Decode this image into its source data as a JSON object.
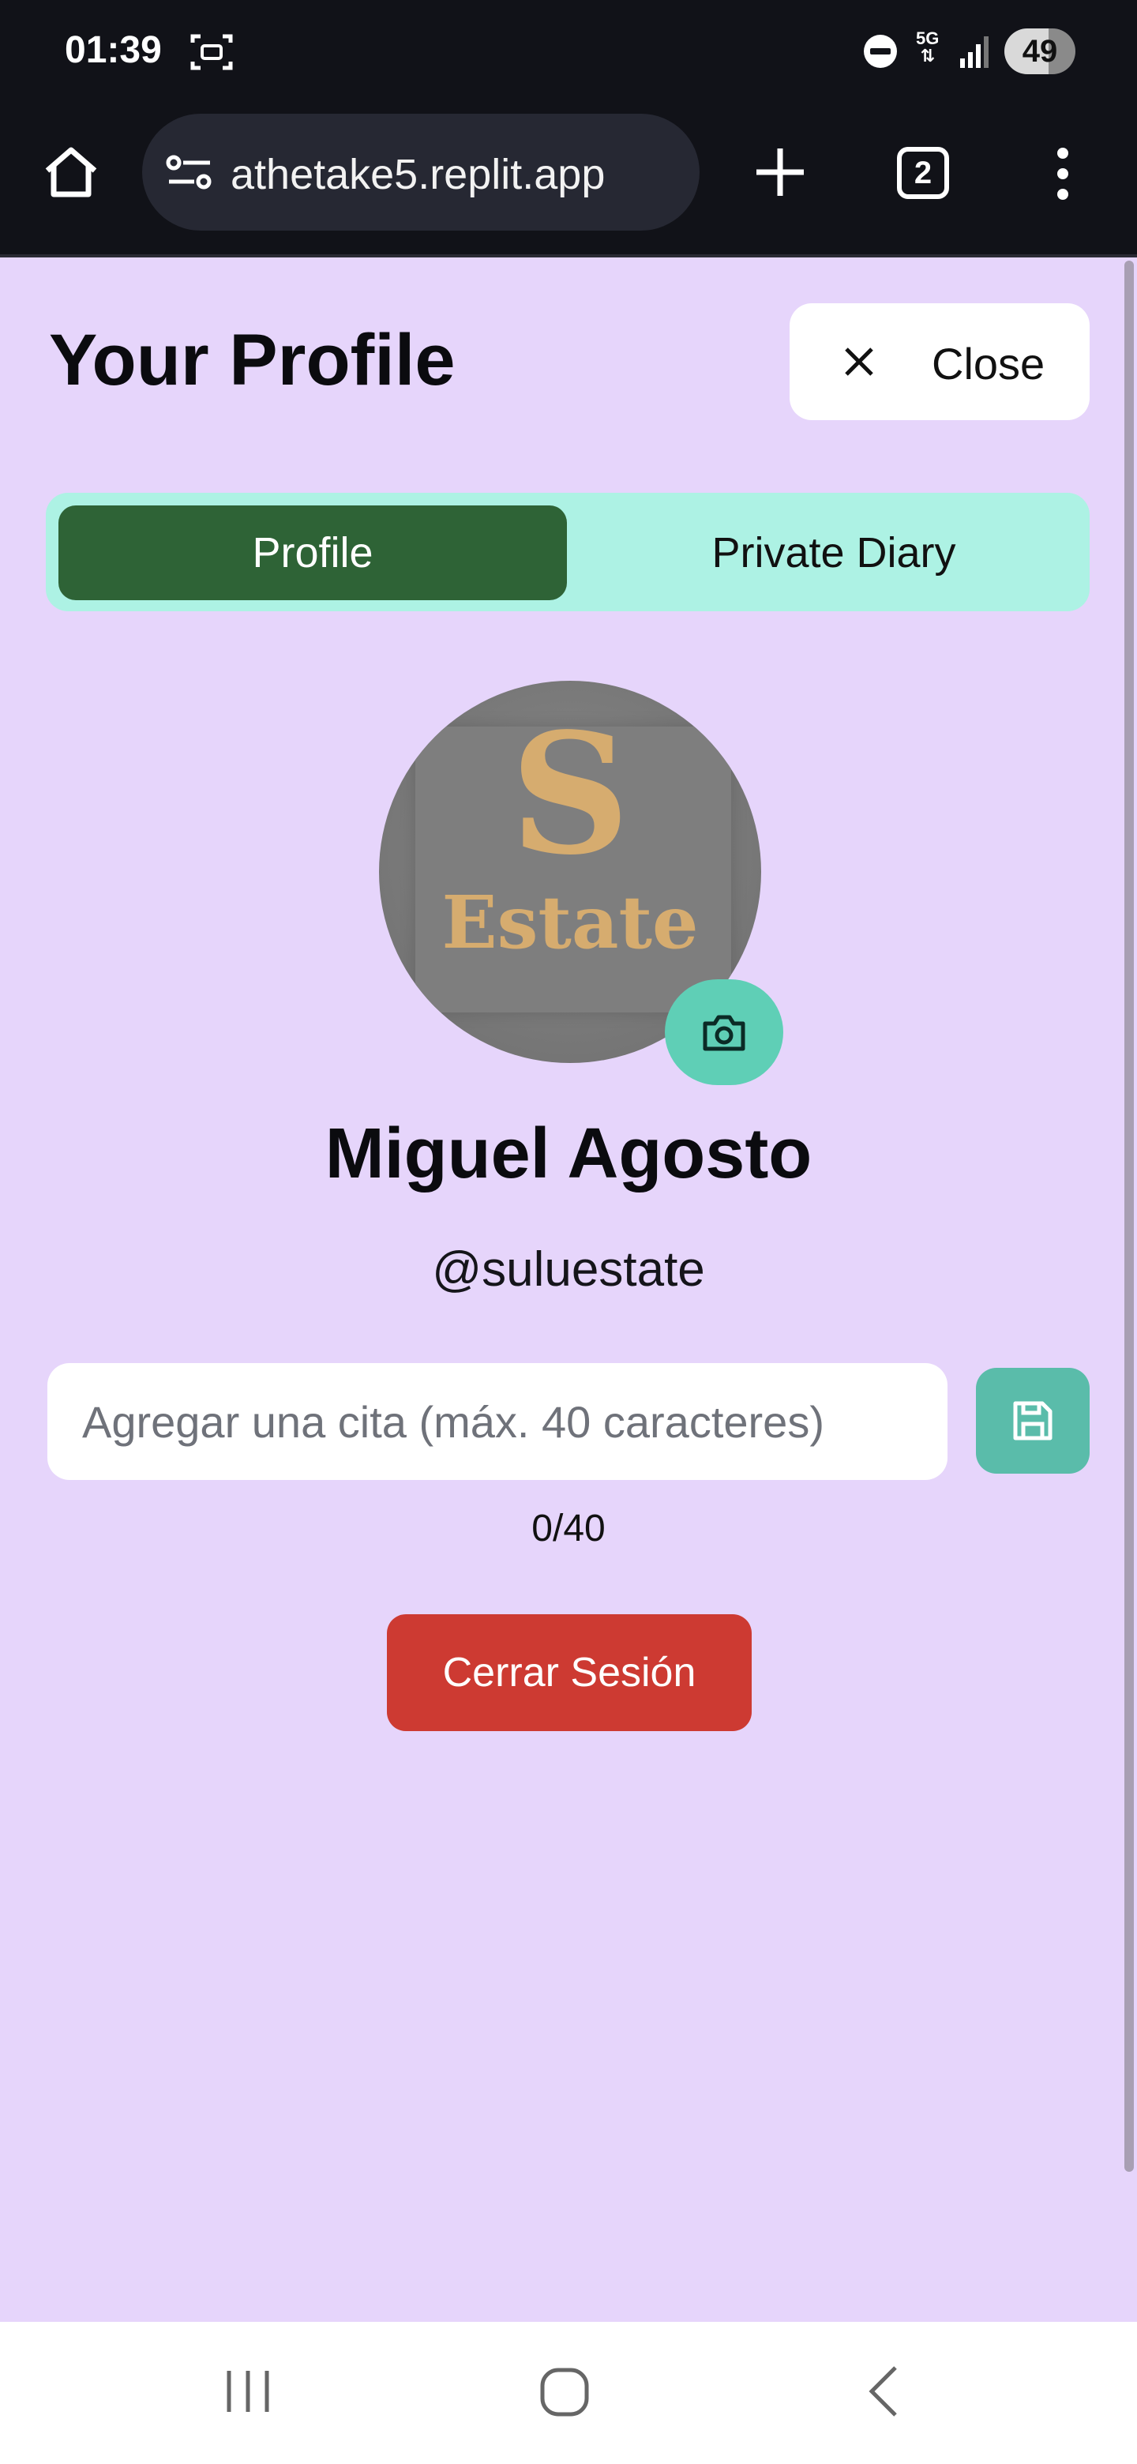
{
  "status_bar": {
    "time": "01:39",
    "network": "5G",
    "battery": "49"
  },
  "browser": {
    "url": "athetake5.replit.app",
    "tab_count": "2"
  },
  "header": {
    "title": "Your Profile",
    "close_label": "Close"
  },
  "tabs": [
    {
      "label": "Profile",
      "active": true
    },
    {
      "label": "Private Diary",
      "active": false
    }
  ],
  "profile": {
    "avatar_letter": "S",
    "avatar_word": "Estate",
    "name": "Miguel Agosto",
    "handle": "@suluestate"
  },
  "quote": {
    "value": "",
    "placeholder": "Agregar una cita (máx. 40 caracteres)",
    "counter": "0/40"
  },
  "logout_label": "Cerrar Sesión",
  "colors": {
    "background": "#e6d5fb",
    "active_tab": "#2e6336",
    "tab_bar": "#adf2e4",
    "accent_teal": "#5fcfb6",
    "logout_red": "#cd3a32"
  }
}
